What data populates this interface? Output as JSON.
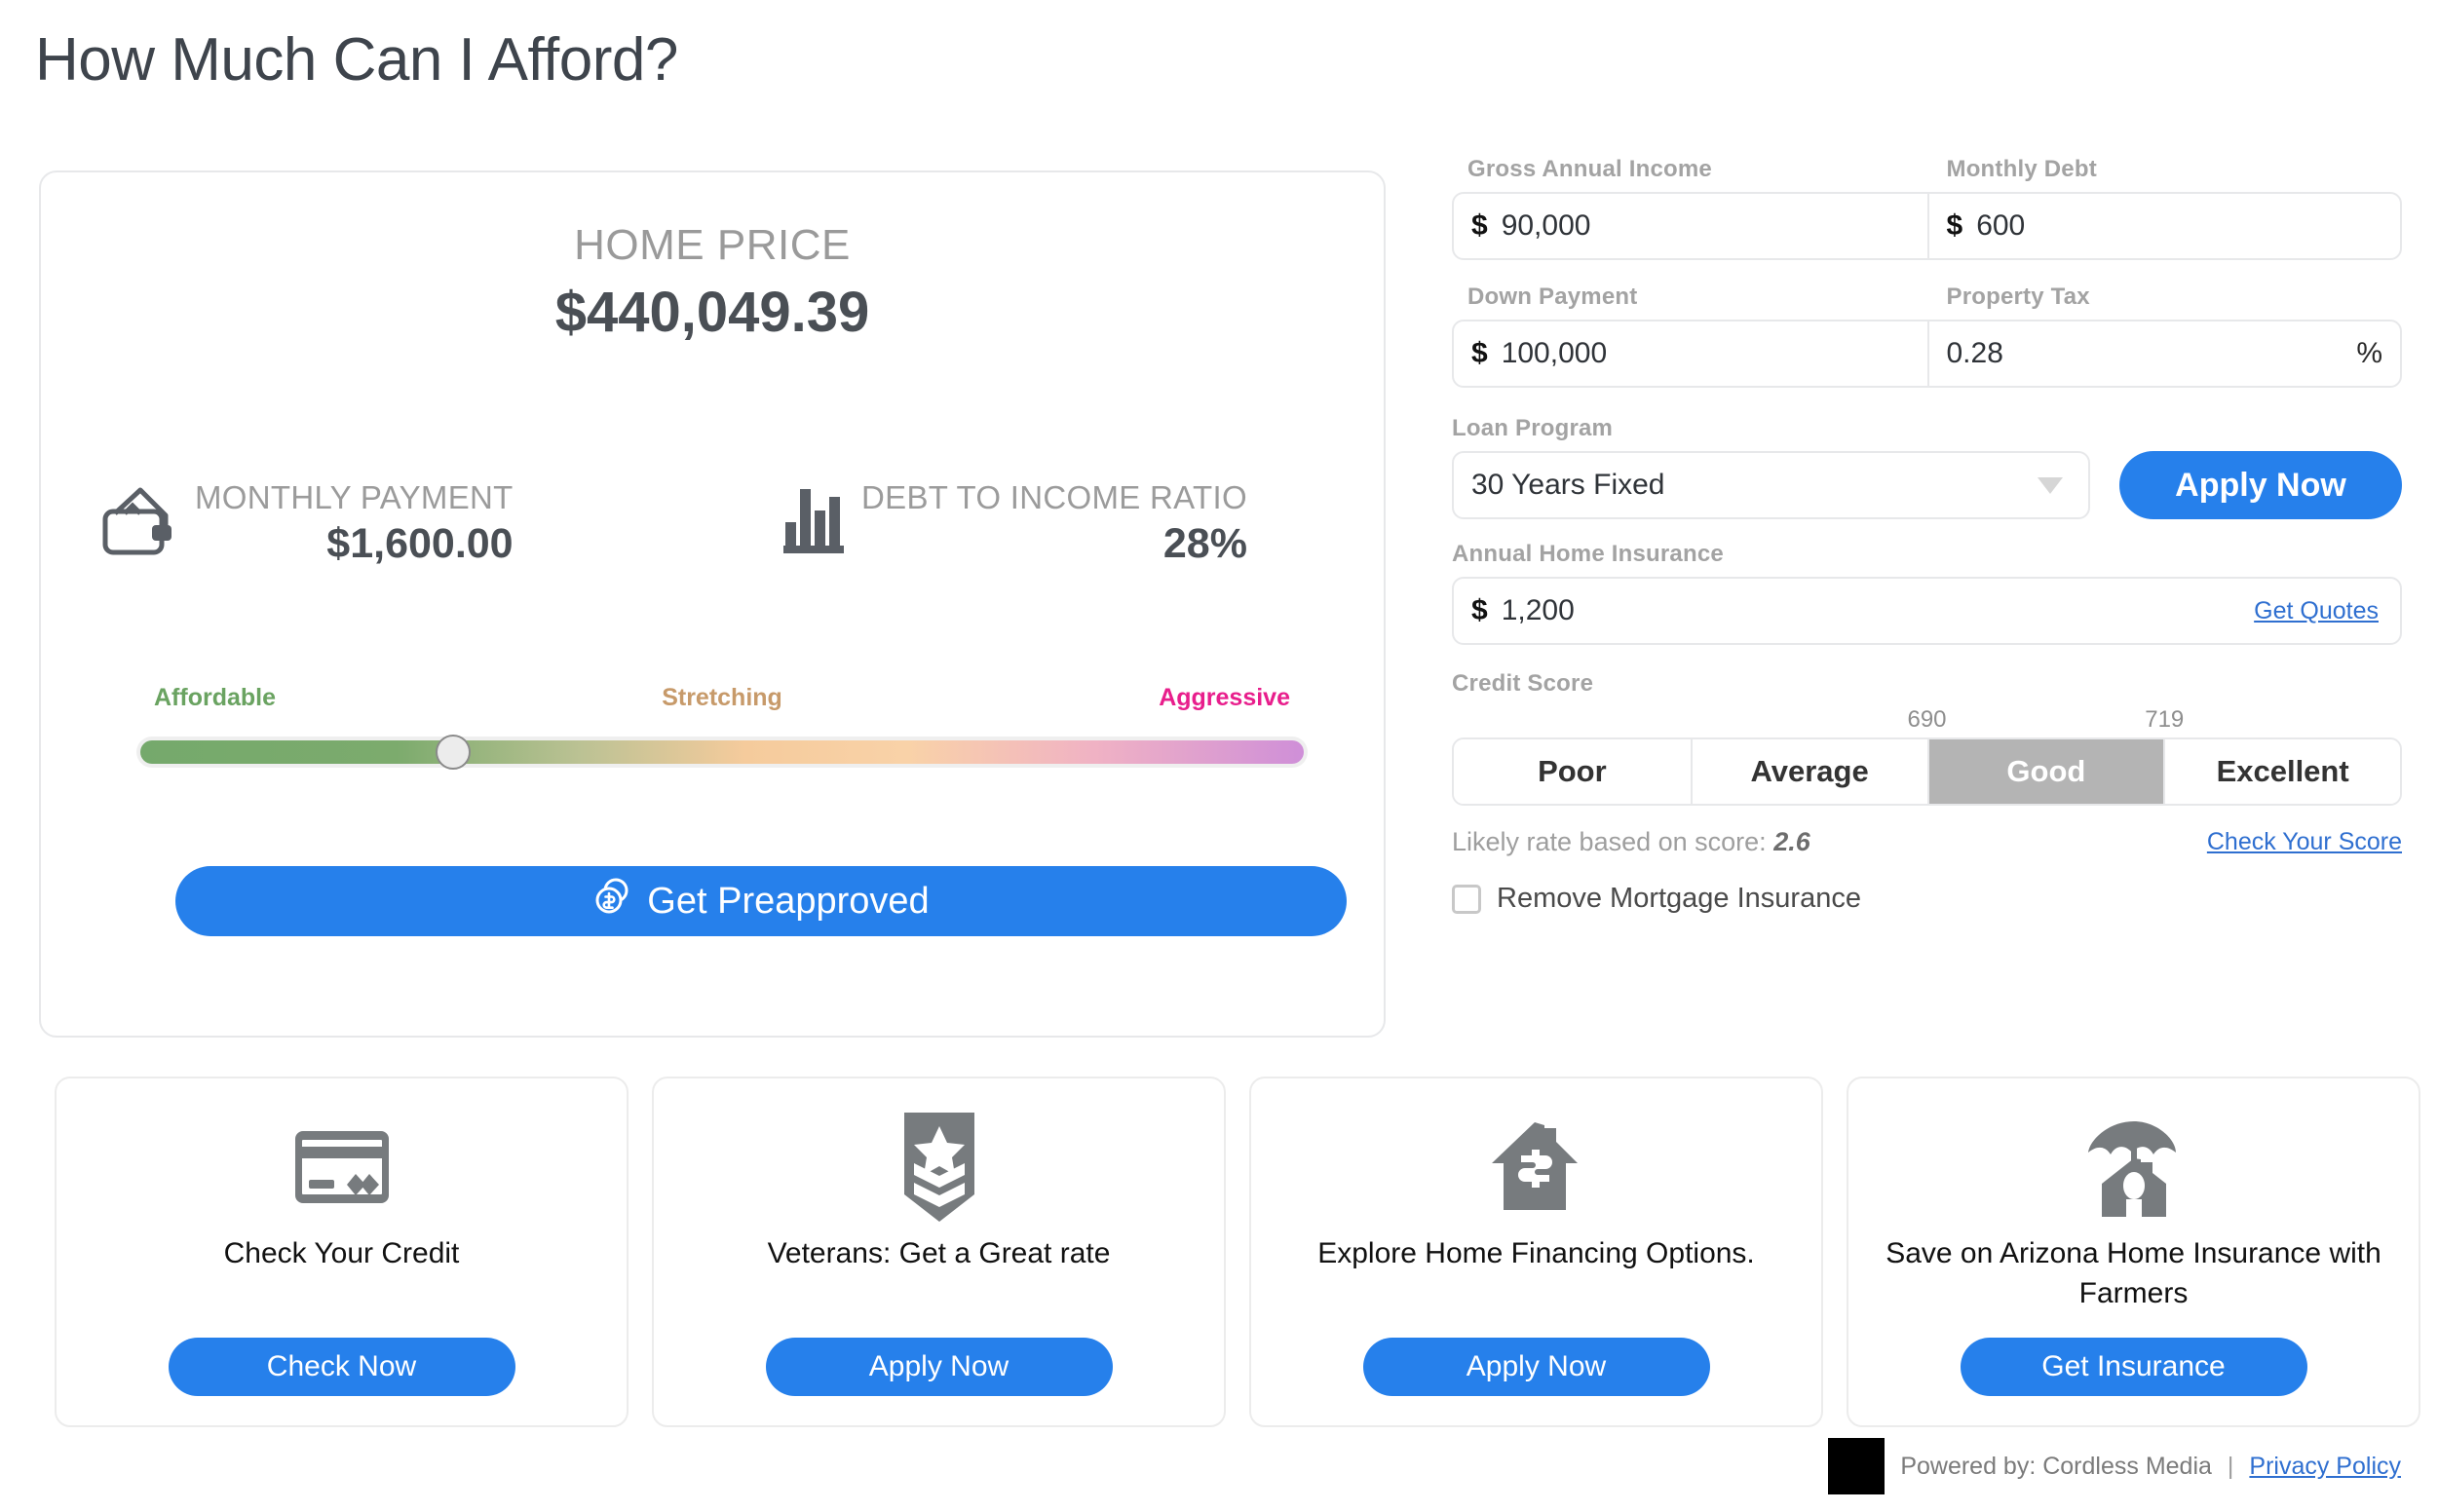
{
  "page": {
    "title": "How Much Can I Afford?"
  },
  "result": {
    "home_price_label": "HOME PRICE",
    "home_price_value": "$440,049.39",
    "metrics": [
      {
        "icon": "wallet-house-icon",
        "label": "MONTHLY PAYMENT",
        "value": "$1,600.00"
      },
      {
        "icon": "bar-chart-icon",
        "label": "DEBT TO INCOME RATIO",
        "value": "28%"
      }
    ],
    "slider": {
      "left_label": "Affordable",
      "mid_label": "Stretching",
      "right_label": "Aggressive",
      "left_color": "#6aa361",
      "mid_color": "#c79a6a",
      "right_color": "#e81e8c",
      "position_percent": 27
    },
    "preapprove_label": "Get Preapproved",
    "preapprove_icon": "coin-dollar-icon"
  },
  "form": {
    "gross_annual_income": {
      "label": "Gross Annual Income",
      "symbol": "$",
      "value": "90,000"
    },
    "monthly_debt": {
      "label": "Monthly Debt",
      "symbol": "$",
      "value": "600"
    },
    "down_payment": {
      "label": "Down Payment",
      "symbol": "$",
      "value": "100,000"
    },
    "property_tax": {
      "label": "Property Tax",
      "value": "0.28",
      "suffix": "%"
    },
    "loan_program": {
      "label": "Loan Program",
      "value": "30 Years Fixed"
    },
    "apply_now_label": "Apply Now",
    "annual_home_insurance": {
      "label": "Annual Home Insurance",
      "symbol": "$",
      "value": "1,200",
      "link": "Get Quotes"
    },
    "credit_score": {
      "label": "Credit Score",
      "tick_low": "690",
      "tick_high": "719",
      "options": [
        "Poor",
        "Average",
        "Good",
        "Excellent"
      ],
      "selected": "Good"
    },
    "rate_text_prefix": "Likely rate based on score:",
    "rate_value": "2.6",
    "check_score_link": "Check Your Score",
    "remove_mortgage_insurance": {
      "label": "Remove Mortgage Insurance",
      "checked": false
    }
  },
  "promos": [
    {
      "icon": "credit-card-icon",
      "title": "Check Your Credit",
      "button": "Check Now"
    },
    {
      "icon": "military-rank-badge-icon",
      "title": "Veterans: Get a Great rate",
      "button": "Apply Now"
    },
    {
      "icon": "house-dollar-icon",
      "title": "Explore Home Financing Options.",
      "button": "Apply Now"
    },
    {
      "icon": "umbrella-house-icon",
      "title": "Save on Arizona Home Insurance with Farmers",
      "button": "Get Insurance"
    }
  ],
  "footer": {
    "powered_by": "Powered by: Cordless Media",
    "separator": "|",
    "privacy_policy": "Privacy Policy"
  },
  "colors": {
    "accent_blue": "#2680eb",
    "link_blue": "#2f6fd0",
    "selected_gray": "#b4b4b4"
  }
}
